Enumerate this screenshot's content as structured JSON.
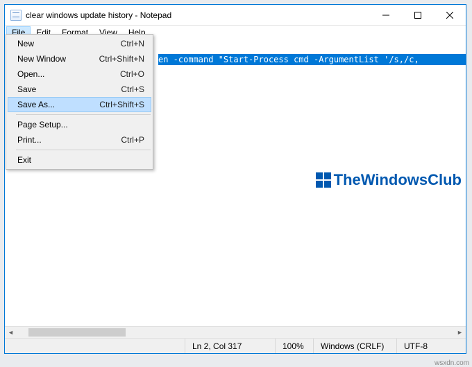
{
  "titlebar": {
    "title": "clear windows update history - Notepad"
  },
  "menubar": {
    "items": [
      "File",
      "Edit",
      "Format",
      "View",
      "Help"
    ],
    "open_index": 0
  },
  "file_menu": {
    "groups": [
      [
        {
          "label": "New",
          "shortcut": "Ctrl+N"
        },
        {
          "label": "New Window",
          "shortcut": "Ctrl+Shift+N"
        },
        {
          "label": "Open...",
          "shortcut": "Ctrl+O"
        },
        {
          "label": "Save",
          "shortcut": "Ctrl+S"
        },
        {
          "label": "Save As...",
          "shortcut": "Ctrl+Shift+S",
          "hover": true
        }
      ],
      [
        {
          "label": "Page Setup..."
        },
        {
          "label": "Print...",
          "shortcut": "Ctrl+P"
        }
      ],
      [
        {
          "label": "Exit"
        }
      ]
    ]
  },
  "editor": {
    "visible_text": "en -command \"Start-Process cmd -ArgumentList '/s,/c,"
  },
  "statusbar": {
    "position": "Ln 2, Col 317",
    "zoom": "100%",
    "line_ending": "Windows (CRLF)",
    "encoding": "UTF-8"
  },
  "watermark": {
    "text": "TheWindowsClub"
  },
  "footer": {
    "text": "wsxdn.com"
  }
}
